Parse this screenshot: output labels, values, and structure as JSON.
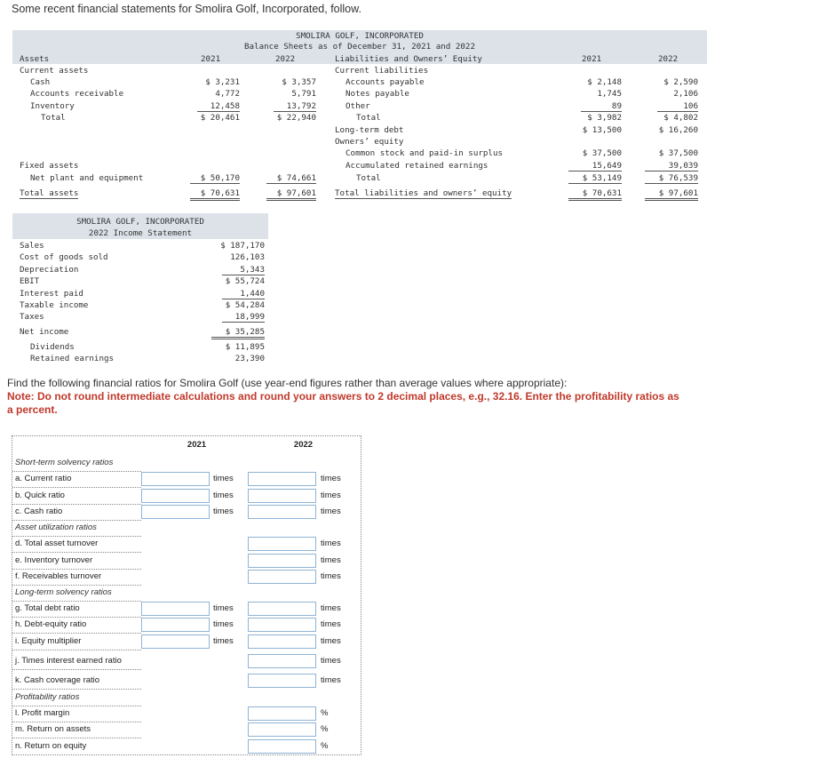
{
  "intro": "Some recent financial statements for Smolira Golf, Incorporated, follow.",
  "balance_sheet": {
    "company": "SMOLIRA GOLF, INCORPORATED",
    "subtitle": "Balance Sheets as of December 31, 2021 and 2022",
    "assets_header": "Assets",
    "liab_header": "Liabilities and Owners’ Equity",
    "year1": "2021",
    "year2": "2022",
    "left": [
      {
        "label": "Current assets",
        "v1": "",
        "v2": ""
      },
      {
        "label": "Cash",
        "v1": "$ 3,231",
        "v2": "$ 3,357"
      },
      {
        "label": "Accounts receivable",
        "v1": "4,772",
        "v2": "5,791"
      },
      {
        "label": "Inventory",
        "v1": "12,458",
        "v2": "13,792"
      },
      {
        "label": "Total",
        "v1": "$ 20,461",
        "v2": "$ 22,940"
      },
      {
        "label": "Fixed assets",
        "v1": "",
        "v2": ""
      },
      {
        "label": "Net plant and equipment",
        "v1": "$ 50,170",
        "v2": "$ 74,661"
      },
      {
        "label": "Total assets",
        "v1": "$ 70,631",
        "v2": "$ 97,601"
      }
    ],
    "right": [
      {
        "label": "Current liabilities",
        "v1": "",
        "v2": ""
      },
      {
        "label": "Accounts payable",
        "v1": "$ 2,148",
        "v2": "$ 2,590"
      },
      {
        "label": "Notes payable",
        "v1": "1,745",
        "v2": "2,106"
      },
      {
        "label": "Other",
        "v1": "89",
        "v2": "106"
      },
      {
        "label": "Total",
        "v1": "$ 3,982",
        "v2": "$ 4,802"
      },
      {
        "label": "Long-term debt",
        "v1": "$ 13,500",
        "v2": "$ 16,260"
      },
      {
        "label": "Owners’ equity",
        "v1": "",
        "v2": ""
      },
      {
        "label": "Common stock and paid-in surplus",
        "v1": "$ 37,500",
        "v2": "$ 37,500"
      },
      {
        "label": "Accumulated retained earnings",
        "v1": "15,649",
        "v2": "39,039"
      },
      {
        "label": "Total",
        "v1": "$ 53,149",
        "v2": "$ 76,539"
      },
      {
        "label": "Total liabilities and owners’ equity",
        "v1": "$ 70,631",
        "v2": "$ 97,601"
      }
    ]
  },
  "income_statement": {
    "company": "SMOLIRA GOLF, INCORPORATED",
    "subtitle": "2022 Income Statement",
    "rows": [
      {
        "label": "Sales",
        "value": "$ 187,170"
      },
      {
        "label": "Cost of goods sold",
        "value": "126,103"
      },
      {
        "label": "Depreciation",
        "value": "5,343"
      },
      {
        "label": "EBIT",
        "value": "$ 55,724"
      },
      {
        "label": "Interest paid",
        "value": "1,440"
      },
      {
        "label": "Taxable income",
        "value": "$ 54,284"
      },
      {
        "label": "Taxes",
        "value": "18,999"
      },
      {
        "label": "Net income",
        "value": "$ 35,285"
      },
      {
        "label": "Dividends",
        "value": "$ 11,895"
      },
      {
        "label": "Retained earnings",
        "value": "23,390"
      }
    ]
  },
  "instructions": "Find the following financial ratios for Smolira Golf (use year-end figures rather than average values where appropriate):",
  "note": "Note: Do not round intermediate calculations and round your answers to 2 decimal places, e.g., 32.16. Enter the profitability ratios as a percent.",
  "ratios": {
    "col1": "2021",
    "col2": "2022",
    "rows": [
      {
        "label": "Short-term solvency ratios",
        "section": true
      },
      {
        "label": "a. Current ratio",
        "unit1": "times",
        "unit2": "times"
      },
      {
        "label": "b. Quick ratio",
        "unit1": "times",
        "unit2": "times"
      },
      {
        "label": "c. Cash ratio",
        "unit1": "times",
        "unit2": "times"
      },
      {
        "label": "Asset utilization ratios",
        "section": true
      },
      {
        "label": "d. Total asset turnover",
        "unit1": "",
        "unit2": "times"
      },
      {
        "label": "e. Inventory turnover",
        "unit1": "",
        "unit2": "times"
      },
      {
        "label": "f. Receivables turnover",
        "unit1": "",
        "unit2": "times"
      },
      {
        "label": "Long-term solvency ratios",
        "section": true
      },
      {
        "label": "g. Total debt ratio",
        "unit1": "times",
        "unit2": "times"
      },
      {
        "label": "h. Debt-equity ratio",
        "unit1": "times",
        "unit2": "times"
      },
      {
        "label": "i. Equity multiplier",
        "unit1": "times",
        "unit2": "times"
      },
      {
        "label": "j. Times interest earned ratio",
        "unit1": "",
        "unit2": "times"
      },
      {
        "label": "k. Cash coverage ratio",
        "unit1": "",
        "unit2": "times"
      },
      {
        "label": "Profitability ratios",
        "section": true
      },
      {
        "label": "l. Profit margin",
        "unit1": "",
        "unit2": "%"
      },
      {
        "label": "m. Return on assets",
        "unit1": "",
        "unit2": "%"
      },
      {
        "label": "n. Return on equity",
        "unit1": "",
        "unit2": "%"
      }
    ]
  }
}
